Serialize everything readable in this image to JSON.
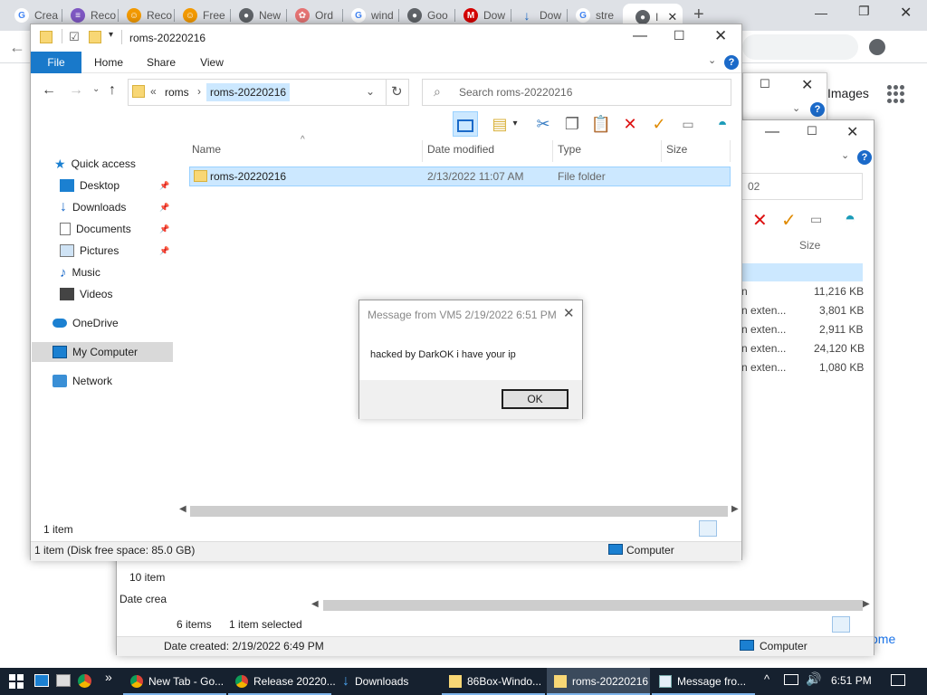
{
  "chrome": {
    "tabs": [
      {
        "label": "Crea",
        "color": "#4285f4",
        "glyph": "G"
      },
      {
        "label": "Reco",
        "color": "#7e57c2",
        "glyph": "≡"
      },
      {
        "label": "Reco",
        "color": "#f29900",
        "glyph": "☺"
      },
      {
        "label": "Free",
        "color": "#f29900",
        "glyph": "☺"
      },
      {
        "label": "New",
        "color": "#5f6368",
        "glyph": "●"
      },
      {
        "label": "Ord",
        "color": "#e57373",
        "glyph": "✿"
      },
      {
        "label": "wind",
        "color": "#4285f4",
        "glyph": "G"
      },
      {
        "label": "Goo",
        "color": "#5f6368",
        "glyph": "●"
      },
      {
        "label": "Dow",
        "color": "#d50000",
        "glyph": "M"
      },
      {
        "label": "Dow",
        "color": "#1b6ac9",
        "glyph": "↓"
      },
      {
        "label": "stre",
        "color": "#4285f4",
        "glyph": "G"
      },
      {
        "label": "I",
        "color": "#5f6368",
        "glyph": "●"
      }
    ],
    "new_tab": "+",
    "images_link": "Images",
    "customize_link": "ome"
  },
  "win2": {
    "search_fragment": "02",
    "size_header": "Size",
    "rows": [
      {
        "type": "n",
        "size": "11,216 KB"
      },
      {
        "type": "n exten...",
        "size": "3,801 KB"
      },
      {
        "type": "n exten...",
        "size": "2,911 KB"
      },
      {
        "type": "n exten...",
        "size": "24,120 KB"
      },
      {
        "type": "n exten...",
        "size": "1,080 KB"
      }
    ],
    "items_left": "10 item",
    "date_created_left": "Date crea",
    "status_count": "6 items",
    "status_selected": "1 item selected",
    "date_created": "Date created: 2/19/2022 6:49 PM",
    "computer": "Computer"
  },
  "main": {
    "title": "roms-20220216",
    "ribbon": {
      "file": "File",
      "home": "Home",
      "share": "Share",
      "view": "View"
    },
    "address": {
      "parent": "roms",
      "current": "roms-20220216",
      "overflow": "«"
    },
    "search_placeholder": "Search roms-20220216",
    "nav": {
      "quick_access": "Quick access",
      "desktop": "Desktop",
      "downloads": "Downloads",
      "documents": "Documents",
      "pictures": "Pictures",
      "music": "Music",
      "videos": "Videos",
      "onedrive": "OneDrive",
      "mycomputer": "My Computer",
      "network": "Network"
    },
    "columns": {
      "name": "Name",
      "date": "Date modified",
      "type": "Type",
      "size": "Size"
    },
    "rows": [
      {
        "name": "roms-20220216",
        "date": "2/13/2022 11:07 AM",
        "type": "File folder",
        "size": ""
      }
    ],
    "item_count": "1 item",
    "status_disk": "1 item (Disk free space: 85.0 GB)",
    "status_computer": "Computer"
  },
  "dialog": {
    "title": "Message from VM5 2/19/2022 6:51 PM",
    "message": "hacked by DarkOK i have your ip",
    "ok": "OK"
  },
  "taskbar": {
    "apps": [
      {
        "label": "New Tab - Go..."
      },
      {
        "label": "Release 20220..."
      },
      {
        "label": "Downloads"
      },
      {
        "label": "86Box-Windo..."
      },
      {
        "label": "roms-20220216"
      },
      {
        "label": "Message fro..."
      }
    ],
    "overflow": "»",
    "clock": "6:51 PM"
  }
}
